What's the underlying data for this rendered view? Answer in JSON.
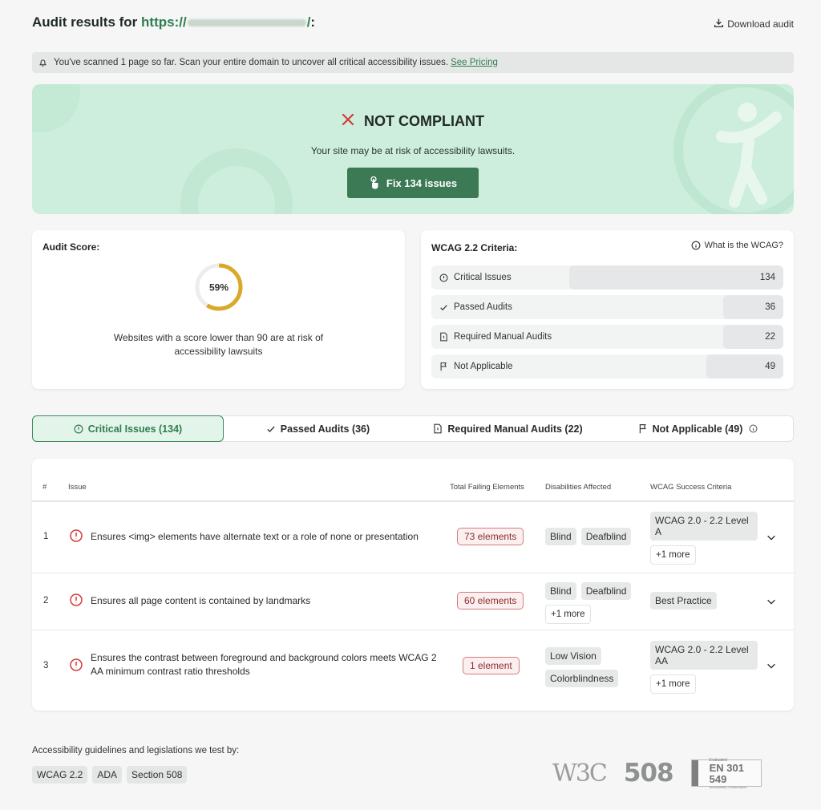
{
  "header": {
    "title_prefix": "Audit results for",
    "url_prefix": "https://",
    "url_suffix": "/",
    "title_suffix": ":",
    "download_label": "Download audit"
  },
  "notice": {
    "text": "You've scanned 1 page so far. Scan your entire domain to uncover all critical accessibility issues.",
    "link": "See Pricing"
  },
  "hero": {
    "status": "NOT COMPLIANT",
    "subtitle": "Your site may be at risk of accessibility lawsuits.",
    "fix_button": "Fix 134 issues"
  },
  "score": {
    "label": "Audit Score:",
    "value_text": "59%",
    "percent": 59,
    "description": "Websites with a score lower than 90 are at risk of accessibility lawsuits"
  },
  "wcag": {
    "label": "WCAG 2.2 Criteria:",
    "what_link": "What is the WCAG?",
    "rows": [
      {
        "icon": "info-circle-icon",
        "label": "Critical Issues",
        "count": "134"
      },
      {
        "icon": "check-icon",
        "label": "Passed Audits",
        "count": "36"
      },
      {
        "icon": "document-icon",
        "label": "Required Manual Audits",
        "count": "22"
      },
      {
        "icon": "flag-icon",
        "label": "Not Applicable",
        "count": "49"
      }
    ]
  },
  "tabs": [
    {
      "label": "Critical Issues (134)",
      "icon": "info-circle-icon",
      "active": true
    },
    {
      "label": "Passed Audits (36)",
      "icon": "check-icon",
      "active": false
    },
    {
      "label": "Required Manual Audits (22)",
      "icon": "document-icon",
      "active": false
    },
    {
      "label": "Not Applicable (49)",
      "icon": "flag-icon",
      "active": false
    }
  ],
  "table": {
    "headers": {
      "num": "#",
      "issue": "Issue",
      "failing": "Total Failing Elements",
      "disabilities": "Disabilities Affected",
      "criteria": "WCAG Success Criteria"
    },
    "rows": [
      {
        "num": "1",
        "issue": "Ensures <img> elements have alternate text or a role of none or presentation",
        "failing": "73 elements",
        "disabilities": [
          "Blind",
          "Deafblind"
        ],
        "disabilities_more": "",
        "criteria": "WCAG 2.0 - 2.2 Level A",
        "criteria_more": "+1 more"
      },
      {
        "num": "2",
        "issue": "Ensures all page content is contained by landmarks",
        "failing": "60 elements",
        "disabilities": [
          "Blind",
          "Deafblind"
        ],
        "disabilities_more": "+1 more",
        "criteria": "Best Practice",
        "criteria_more": ""
      },
      {
        "num": "3",
        "issue": "Ensures the contrast between foreground and background colors meets WCAG 2 AA minimum contrast ratio thresholds",
        "failing": "1 element",
        "disabilities": [
          "Low Vision",
          "Colorblindness"
        ],
        "disabilities_more": "",
        "criteria": "WCAG 2.0 - 2.2 Level AA",
        "criteria_more": "+1 more"
      }
    ]
  },
  "footer": {
    "label": "Accessibility guidelines and legislations we test by:",
    "tags": [
      "WCAG 2.2",
      "ADA",
      "Section 508"
    ],
    "logos": {
      "w3c": "W3C",
      "s508": "508",
      "en_small": "Evaluated",
      "en_main": "EN 301 549",
      "en_caption": "Accessibility Conformance"
    }
  },
  "colors": {
    "accent": "#2e7d4f",
    "hero_bg": "#cdeedd",
    "button": "#3b7a54",
    "donut": "#d9a92a",
    "error": "#d23b3b"
  }
}
